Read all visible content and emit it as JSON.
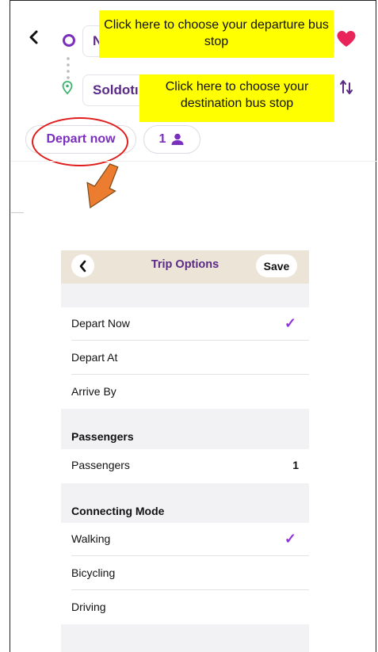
{
  "search": {
    "origin_value": "N",
    "destination_value": "Soldotı",
    "back_icon": "chevron-left-icon",
    "favorite_icon": "heart-icon",
    "swap_icon": "swap-vertical-icon",
    "accent_color": "#7b2fbe"
  },
  "callouts": {
    "departure": "Click here to choose your departure bus stop",
    "destination": "Click here to choose your destination bus stop"
  },
  "chips": {
    "depart_label": "Depart now",
    "passengers_count": "1",
    "passengers_icon": "person-icon"
  },
  "trip_options": {
    "header": {
      "title": "Trip Options",
      "save_label": "Save",
      "back_icon": "chevron-left-icon"
    },
    "time_options": [
      {
        "label": "Depart Now",
        "selected": true
      },
      {
        "label": "Depart At",
        "selected": false
      },
      {
        "label": "Arrive By",
        "selected": false
      }
    ],
    "passengers_section": {
      "title": "Passengers",
      "row_label": "Passengers",
      "value": "1"
    },
    "connecting_section": {
      "title": "Connecting Mode",
      "modes": [
        {
          "label": "Walking",
          "selected": true
        },
        {
          "label": "Bicycling",
          "selected": false
        },
        {
          "label": "Driving",
          "selected": false
        }
      ]
    },
    "checkmark": "✓"
  }
}
